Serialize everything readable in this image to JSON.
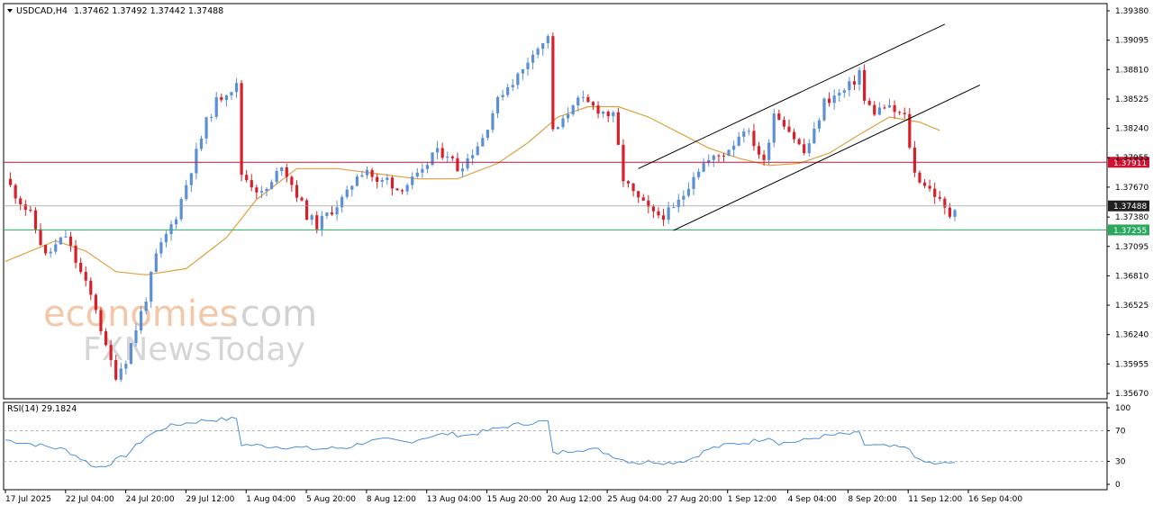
{
  "chart_header": {
    "symbol_label": "USDCAD,H4",
    "ohlc": "1.37462 1.37492 1.37442 1.37488",
    "menu_icon": "triangle-down-icon"
  },
  "rsi_header": {
    "label": "RSI(14) 29.1824"
  },
  "watermark": {
    "line1_part1": "economies",
    "line1_part2": ".com",
    "line2": "FXNewsToday"
  },
  "colors": {
    "bull": "#5b8fd6",
    "bear": "#d8202a",
    "ma": "#e0a040",
    "resistance": "#d01030",
    "support": "#2aa860",
    "current": "#202020",
    "rsi": "#4a90d9",
    "frame": "#000000"
  },
  "chart_data": [
    {
      "type": "candlestick",
      "title": "USDCAD, H4",
      "x_tick_labels": [
        "17 Jul 2025",
        "22 Jul 04:00",
        "24 Jul 20:00",
        "29 Jul 12:00",
        "1 Aug 04:00",
        "5 Aug 20:00",
        "8 Aug 12:00",
        "13 Aug 04:00",
        "15 Aug 20:00",
        "20 Aug 12:00",
        "25 Aug 04:00",
        "27 Aug 20:00",
        "1 Sep 12:00",
        "4 Sep 04:00",
        "8 Sep 20:00",
        "11 Sep 12:00",
        "16 Sep 04:00"
      ],
      "y_tick_labels": [
        "1.39380",
        "1.39095",
        "1.38810",
        "1.38525",
        "1.38240",
        "1.37955",
        "1.37670",
        "1.37380",
        "1.37095",
        "1.36810",
        "1.36525",
        "1.36240",
        "1.35955",
        "1.35670"
      ],
      "ylim": [
        1.3567,
        1.3938
      ],
      "x_index_range": [
        0,
        140
      ],
      "close_path": [
        [
          0,
          1.3775
        ],
        [
          2,
          1.376
        ],
        [
          5,
          1.374
        ],
        [
          8,
          1.37
        ],
        [
          12,
          1.372
        ],
        [
          14,
          1.3695
        ],
        [
          18,
          1.365
        ],
        [
          20,
          1.361
        ],
        [
          22,
          1.3585
        ],
        [
          24,
          1.36
        ],
        [
          26,
          1.363
        ],
        [
          28,
          1.366
        ],
        [
          30,
          1.37
        ],
        [
          32,
          1.372
        ],
        [
          34,
          1.374
        ],
        [
          36,
          1.377
        ],
        [
          38,
          1.38
        ],
        [
          40,
          1.383
        ],
        [
          42,
          1.385
        ],
        [
          44,
          1.386
        ],
        [
          46,
          1.3865
        ],
        [
          47,
          1.378
        ],
        [
          49,
          1.377
        ],
        [
          51,
          1.376
        ],
        [
          53,
          1.377
        ],
        [
          55,
          1.379
        ],
        [
          57,
          1.377
        ],
        [
          60,
          1.374
        ],
        [
          62,
          1.373
        ],
        [
          64,
          1.374
        ],
        [
          66,
          1.375
        ],
        [
          68,
          1.376
        ],
        [
          70,
          1.378
        ],
        [
          72,
          1.3785
        ],
        [
          74,
          1.377
        ],
        [
          76,
          1.3775
        ],
        [
          78,
          1.3765
        ],
        [
          80,
          1.377
        ],
        [
          83,
          1.378
        ],
        [
          85,
          1.38
        ],
        [
          88,
          1.38
        ],
        [
          90,
          1.3785
        ],
        [
          92,
          1.3795
        ],
        [
          95,
          1.3815
        ],
        [
          97,
          1.384
        ],
        [
          99,
          1.386
        ],
        [
          101,
          1.387
        ],
        [
          103,
          1.388
        ],
        [
          105,
          1.39
        ],
        [
          107,
          1.3905
        ],
        [
          108,
          1.3915
        ],
        [
          109,
          1.382
        ],
        [
          111,
          1.383
        ],
        [
          113,
          1.385
        ],
        [
          115,
          1.385
        ],
        [
          117,
          1.3845
        ],
        [
          119,
          1.384
        ],
        [
          121,
          1.3835
        ],
        [
          123,
          1.3775
        ],
        [
          125,
          1.376
        ],
        [
          127,
          1.375
        ],
        [
          129,
          1.374
        ],
        [
          131,
          1.374
        ],
        [
          133,
          1.3745
        ],
        [
          135,
          1.376
        ],
        [
          137,
          1.378
        ],
        [
          139,
          1.379
        ],
        [
          141,
          1.3795
        ],
        [
          143,
          1.38
        ],
        [
          145,
          1.381
        ],
        [
          147,
          1.3825
        ],
        [
          149,
          1.381
        ],
        [
          151,
          1.379
        ],
        [
          153,
          1.384
        ],
        [
          155,
          1.383
        ],
        [
          157,
          1.3815
        ],
        [
          159,
          1.38
        ],
        [
          161,
          1.382
        ],
        [
          163,
          1.385
        ],
        [
          165,
          1.3855
        ],
        [
          167,
          1.386
        ],
        [
          169,
          1.387
        ],
        [
          170,
          1.388
        ],
        [
          171,
          1.385
        ],
        [
          173,
          1.384
        ],
        [
          175,
          1.3845
        ],
        [
          177,
          1.384
        ],
        [
          179,
          1.3835
        ],
        [
          181,
          1.378
        ],
        [
          183,
          1.377
        ],
        [
          185,
          1.376
        ],
        [
          187,
          1.3745
        ],
        [
          188,
          1.374
        ],
        [
          189,
          1.3749
        ]
      ],
      "moving_average_path": [
        [
          0,
          1.3695
        ],
        [
          10,
          1.3715
        ],
        [
          16,
          1.3705
        ],
        [
          22,
          1.3685
        ],
        [
          28,
          1.3682
        ],
        [
          36,
          1.3688
        ],
        [
          44,
          1.3718
        ],
        [
          50,
          1.3755
        ],
        [
          58,
          1.3785
        ],
        [
          66,
          1.3785
        ],
        [
          74,
          1.378
        ],
        [
          82,
          1.3775
        ],
        [
          90,
          1.3775
        ],
        [
          98,
          1.379
        ],
        [
          104,
          1.381
        ],
        [
          110,
          1.3835
        ],
        [
          116,
          1.3845
        ],
        [
          122,
          1.3845
        ],
        [
          128,
          1.3835
        ],
        [
          134,
          1.382
        ],
        [
          140,
          1.3805
        ],
        [
          146,
          1.3795
        ],
        [
          152,
          1.3788
        ],
        [
          158,
          1.379
        ],
        [
          164,
          1.38
        ],
        [
          170,
          1.3818
        ],
        [
          176,
          1.3835
        ],
        [
          182,
          1.383
        ],
        [
          186,
          1.3822
        ]
      ],
      "horizontal_levels": [
        {
          "label": "1.37911",
          "value": 1.37911,
          "role": "resistance"
        },
        {
          "label": "1.37488",
          "value": 1.37488,
          "role": "current"
        },
        {
          "label": "1.37255",
          "value": 1.37255,
          "role": "support"
        }
      ],
      "channel_lines": [
        {
          "role": "upper",
          "points": [
            [
              126,
              1.3785
            ],
            [
              187,
              1.3925
            ]
          ]
        },
        {
          "role": "lower",
          "points": [
            [
              133,
              1.3725
            ],
            [
              194,
              1.3866
            ]
          ]
        }
      ]
    },
    {
      "type": "line",
      "title": "RSI(14) 29.1824",
      "y_tick_labels": [
        "100",
        "70",
        "30",
        "0"
      ],
      "ylim": [
        0,
        100
      ],
      "reference_levels": [
        70,
        30
      ],
      "values": [
        [
          0,
          58
        ],
        [
          6,
          52
        ],
        [
          12,
          45
        ],
        [
          16,
          30
        ],
        [
          18,
          22
        ],
        [
          20,
          25
        ],
        [
          24,
          38
        ],
        [
          28,
          62
        ],
        [
          32,
          75
        ],
        [
          36,
          80
        ],
        [
          40,
          84
        ],
        [
          44,
          85
        ],
        [
          46,
          86
        ],
        [
          47,
          52
        ],
        [
          52,
          50
        ],
        [
          58,
          48
        ],
        [
          62,
          46
        ],
        [
          68,
          48
        ],
        [
          72,
          56
        ],
        [
          76,
          58
        ],
        [
          80,
          55
        ],
        [
          84,
          62
        ],
        [
          88,
          66
        ],
        [
          92,
          64
        ],
        [
          96,
          70
        ],
        [
          100,
          76
        ],
        [
          104,
          80
        ],
        [
          107,
          82
        ],
        [
          108,
          82
        ],
        [
          109,
          40
        ],
        [
          114,
          46
        ],
        [
          118,
          45
        ],
        [
          123,
          32
        ],
        [
          126,
          28
        ],
        [
          129,
          30
        ],
        [
          132,
          28
        ],
        [
          136,
          32
        ],
        [
          140,
          46
        ],
        [
          144,
          52
        ],
        [
          148,
          55
        ],
        [
          152,
          62
        ],
        [
          154,
          54
        ],
        [
          158,
          56
        ],
        [
          162,
          62
        ],
        [
          166,
          65
        ],
        [
          170,
          66
        ],
        [
          171,
          52
        ],
        [
          174,
          50
        ],
        [
          178,
          48
        ],
        [
          180,
          46
        ],
        [
          182,
          30
        ],
        [
          186,
          26
        ],
        [
          189,
          29
        ]
      ]
    }
  ]
}
